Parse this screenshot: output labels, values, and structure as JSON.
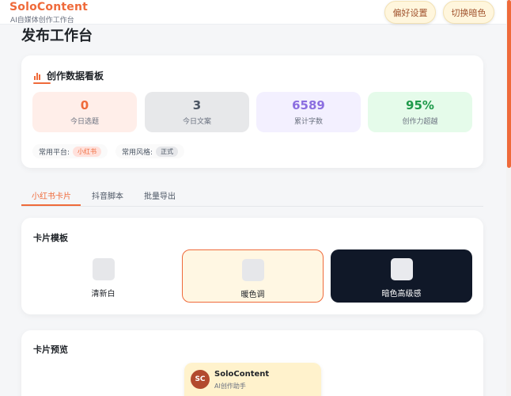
{
  "header": {
    "brand_name": "SoloContent",
    "brand_sub": "AI自媒体创作工作台",
    "pref_button": "偏好设置",
    "dark_button": "切换暗色"
  },
  "page": {
    "title": "发布工作台"
  },
  "stats_panel": {
    "title": "创作数据看板",
    "stats": [
      {
        "value": "0",
        "label": "今日选题"
      },
      {
        "value": "3",
        "label": "今日文案"
      },
      {
        "value": "6589",
        "label": "累计字数"
      },
      {
        "value": "95%",
        "label": "创作力超越"
      }
    ],
    "platform_label": "常用平台:",
    "platform_value": "小红书",
    "style_label": "常用风格:",
    "style_value": "正式"
  },
  "tabs": [
    {
      "label": "小红书卡片",
      "active": true
    },
    {
      "label": "抖音脚本",
      "active": false
    },
    {
      "label": "批量导出",
      "active": false
    }
  ],
  "templates": {
    "title": "卡片模板",
    "items": [
      {
        "name": "清新白"
      },
      {
        "name": "暖色调"
      },
      {
        "name": "暗色高级感"
      }
    ]
  },
  "preview": {
    "title": "卡片预览",
    "avatar_initials": "SC",
    "name": "SoloContent",
    "subtitle": "AI创作助手"
  },
  "colors": {
    "accent": "#ef6a3a",
    "dark_template": "#101828",
    "warm_template": "#fff7e3"
  }
}
